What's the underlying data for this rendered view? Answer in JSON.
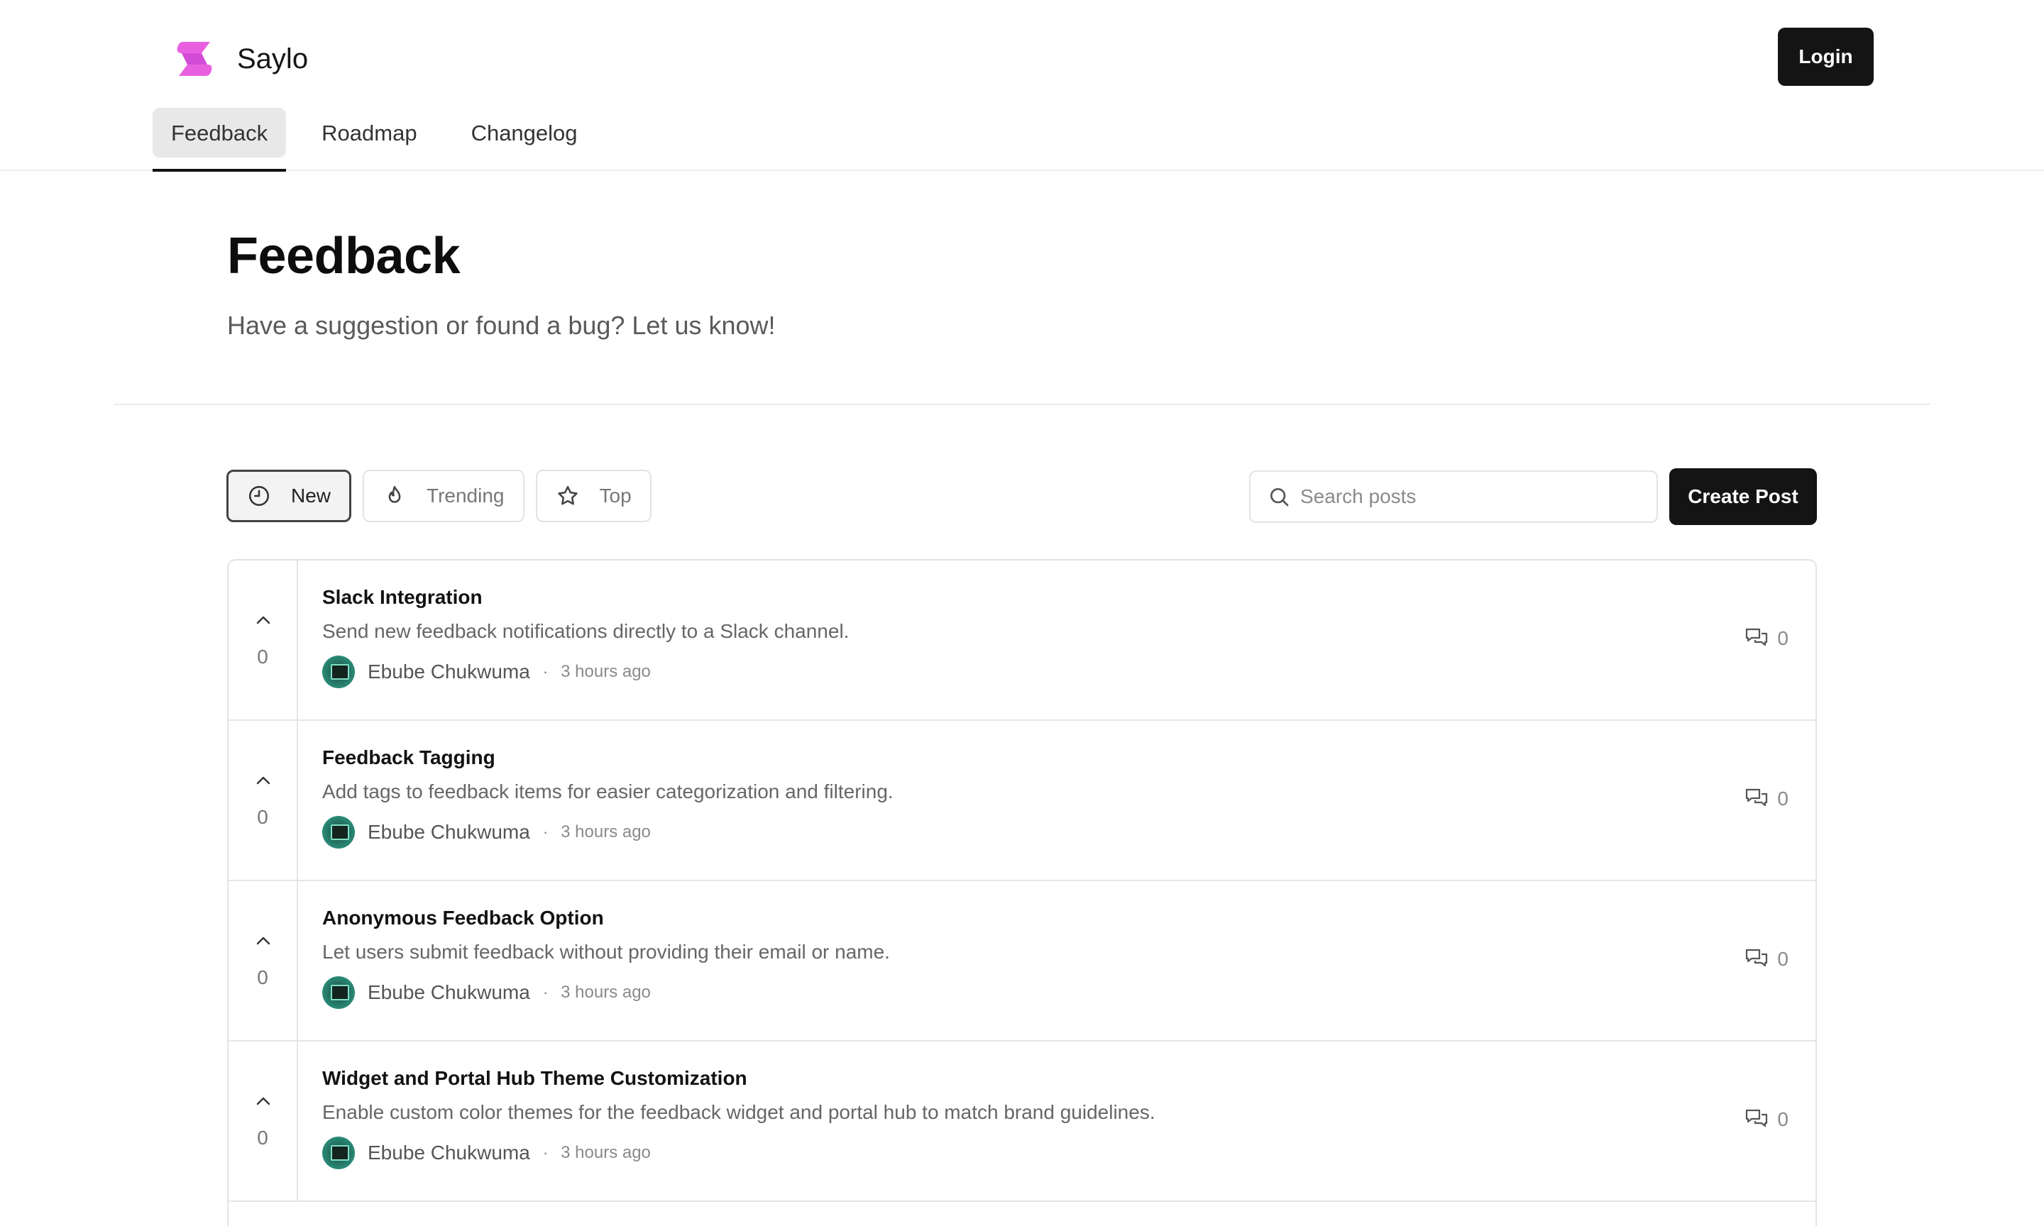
{
  "brand": {
    "name": "Saylo",
    "logo_icon": "saylo-logo-icon",
    "accent": "#e860e0"
  },
  "header": {
    "login_label": "Login"
  },
  "nav": {
    "tabs": [
      {
        "label": "Feedback",
        "active": true
      },
      {
        "label": "Roadmap",
        "active": false
      },
      {
        "label": "Changelog",
        "active": false
      }
    ]
  },
  "page": {
    "title": "Feedback",
    "subtitle": "Have a suggestion or found a bug? Let us know!"
  },
  "filters": [
    {
      "label": "New",
      "icon": "clock-icon",
      "active": true
    },
    {
      "label": "Trending",
      "icon": "flame-icon",
      "active": false
    },
    {
      "label": "Top",
      "icon": "star-icon",
      "active": false
    }
  ],
  "search": {
    "placeholder": "Search posts",
    "value": ""
  },
  "create_post_label": "Create Post",
  "posts": [
    {
      "title": "Slack Integration",
      "description": "Send new feedback notifications directly to a Slack channel.",
      "author": "Ebube Chukwuma",
      "time": "3 hours ago",
      "votes": "0",
      "comments": "0"
    },
    {
      "title": "Feedback Tagging",
      "description": "Add tags to feedback items for easier categorization and filtering.",
      "author": "Ebube Chukwuma",
      "time": "3 hours ago",
      "votes": "0",
      "comments": "0"
    },
    {
      "title": "Anonymous Feedback Option",
      "description": "Let users submit feedback without providing their email or name.",
      "author": "Ebube Chukwuma",
      "time": "3 hours ago",
      "votes": "0",
      "comments": "0"
    },
    {
      "title": "Widget and Portal Hub Theme Customization",
      "description": "Enable custom color themes for the feedback widget and portal hub to match brand guidelines.",
      "author": "Ebube Chukwuma",
      "time": "3 hours ago",
      "votes": "0",
      "comments": "0"
    }
  ],
  "meta_separator": "·"
}
